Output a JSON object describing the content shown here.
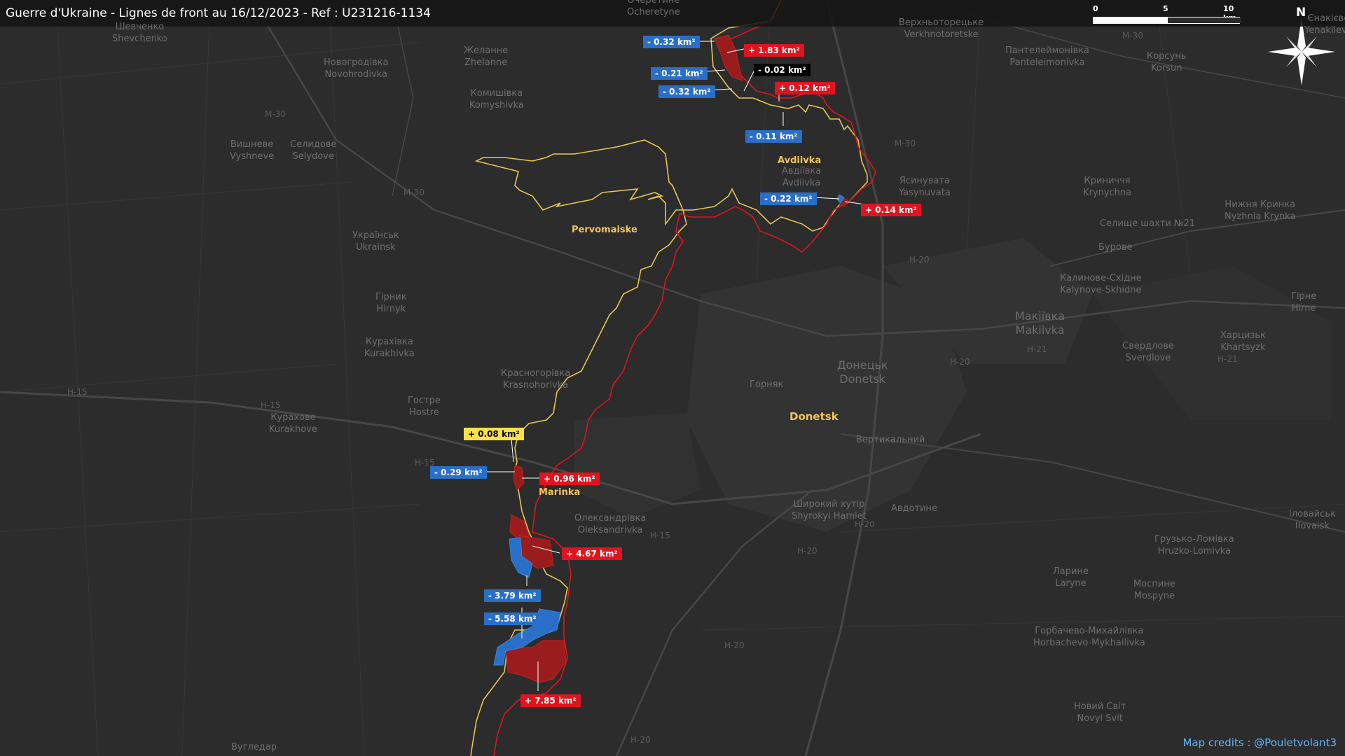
{
  "title": "Guerre d'Ukraine - Lignes de front au 16/12/2023 - Ref : U231216-1134",
  "credits": "Map credits : @Pouletvolant3",
  "scale": {
    "t0": "0",
    "t5": "5",
    "t10": "10 km"
  },
  "north": "N",
  "colors": {
    "ua_line": "#e6c454",
    "ru_line": "#e0141e",
    "gain_fill": "#9b1c1c",
    "loss_fill": "#2a6fc7"
  },
  "badges": [
    {
      "text": "- 0.32 km²",
      "kind": "loss"
    },
    {
      "text": "+ 1.83 km²",
      "kind": "gain"
    },
    {
      "text": "- 0.21 km²",
      "kind": "loss"
    },
    {
      "text": "- 0.02 km²",
      "kind": "neutral"
    },
    {
      "text": "- 0.32 km²",
      "kind": "loss"
    },
    {
      "text": "+ 0.12 km²",
      "kind": "gain"
    },
    {
      "text": "- 0.11 km²",
      "kind": "loss"
    },
    {
      "text": "- 0.22 km²",
      "kind": "loss"
    },
    {
      "text": "+ 0.14 km²",
      "kind": "gain"
    },
    {
      "text": "+ 0.08 km²",
      "kind": "yellow"
    },
    {
      "text": "- 0.29 km²",
      "kind": "loss"
    },
    {
      "text": "+ 0.96 km²",
      "kind": "gain"
    },
    {
      "text": "+ 4.67 km²",
      "kind": "gain"
    },
    {
      "text": "- 3.79 km²",
      "kind": "loss"
    },
    {
      "text": "- 5.58 km²",
      "kind": "loss"
    },
    {
      "text": "+ 7.85 km²",
      "kind": "gain"
    }
  ],
  "towns": {
    "avdiivka": "Avdiivka",
    "pervomaiske": "Pervomaiske",
    "marinka": "Marinka",
    "donetsk": "Donetsk"
  },
  "places": [
    {
      "uk": "Шевченко",
      "en": "Shevchenko"
    },
    {
      "uk": "Очеретине",
      "en": "Ocheretyne"
    },
    {
      "uk": "Новогродівка",
      "en": "Novohrodivka"
    },
    {
      "uk": "Желанне",
      "en": "Zhelanne"
    },
    {
      "uk": "Комишівка",
      "en": "Komyshivka"
    },
    {
      "uk": "Вишневе",
      "en": "Vyshneve"
    },
    {
      "uk": "Селидове",
      "en": "Selydove"
    },
    {
      "uk": "Українськ",
      "en": "Ukrainsk"
    },
    {
      "uk": "Гірник",
      "en": "Hirnyk"
    },
    {
      "uk": "Курахівка",
      "en": "Kurakhivka"
    },
    {
      "uk": "Красногорівка",
      "en": "Krasnohorivka"
    },
    {
      "uk": "Гостре",
      "en": "Hostre"
    },
    {
      "uk": "Курахове",
      "en": "Kurakhove"
    },
    {
      "uk": "Олександрівка",
      "en": "Oleksandrivka"
    },
    {
      "uk": "Авдіївка",
      "en": "Avdiivka"
    },
    {
      "uk": "Ясинувата",
      "en": "Yasynuvata"
    },
    {
      "uk": "Верхньоторецьке",
      "en": "Verkhnotoretske"
    },
    {
      "uk": "Пантелеймонівка",
      "en": "Panteleimonivka"
    },
    {
      "uk": "Корсунь",
      "en": "Korsun"
    },
    {
      "uk": "Криниччя",
      "en": "Krynychna"
    },
    {
      "uk": "Нижня Кринка",
      "en": "Nyzhnia Krynka"
    },
    {
      "uk": "Калинове-Східне",
      "en": "Kalynove-Skhidne"
    },
    {
      "uk": "Макіївка",
      "en": "Makiivka"
    },
    {
      "uk": "Свердлове",
      "en": "Sverdlove"
    },
    {
      "uk": "Харцизьк",
      "en": "Khartsyzk"
    },
    {
      "uk": "Гірне",
      "en": "Hirne"
    },
    {
      "uk": "Донецьк",
      "en": "Donetsk"
    },
    {
      "uk": "Широкий хутір",
      "en": "Shyrokyi Hamlet"
    },
    {
      "uk": "Ларине",
      "en": "Laryne"
    },
    {
      "uk": "Моспине",
      "en": "Mospyne"
    },
    {
      "uk": "Грузько-Ломівка",
      "en": "Hruzko-Lomivka"
    },
    {
      "uk": "Іловайськ",
      "en": "Ilovaisk"
    },
    {
      "uk": "Горбачево-Михайлівка",
      "en": "Horbachevo-Mykhailivka"
    },
    {
      "uk": "Новий Світ",
      "en": "Novyi Svit"
    },
    {
      "uk": "Вугледар",
      "en": ""
    }
  ],
  "minor_labels": {
    "selyshche": "Селище шахти №21",
    "burose": "Бурове",
    "horniak": "Горняк",
    "vertykalnyi": "Вертикальний",
    "avdotyne": "Авдотине",
    "yenakiieve": "Yenakiieve",
    "yenakiieve_uk": "Єнакієве"
  },
  "roads": [
    "M-30",
    "M-30",
    "M-30",
    "M-30",
    "H-20",
    "H-20",
    "H-20",
    "H-20",
    "H-15",
    "H-15",
    "H-15",
    "H-15",
    "H-21",
    "H-21",
    "H-20",
    "H-20"
  ]
}
